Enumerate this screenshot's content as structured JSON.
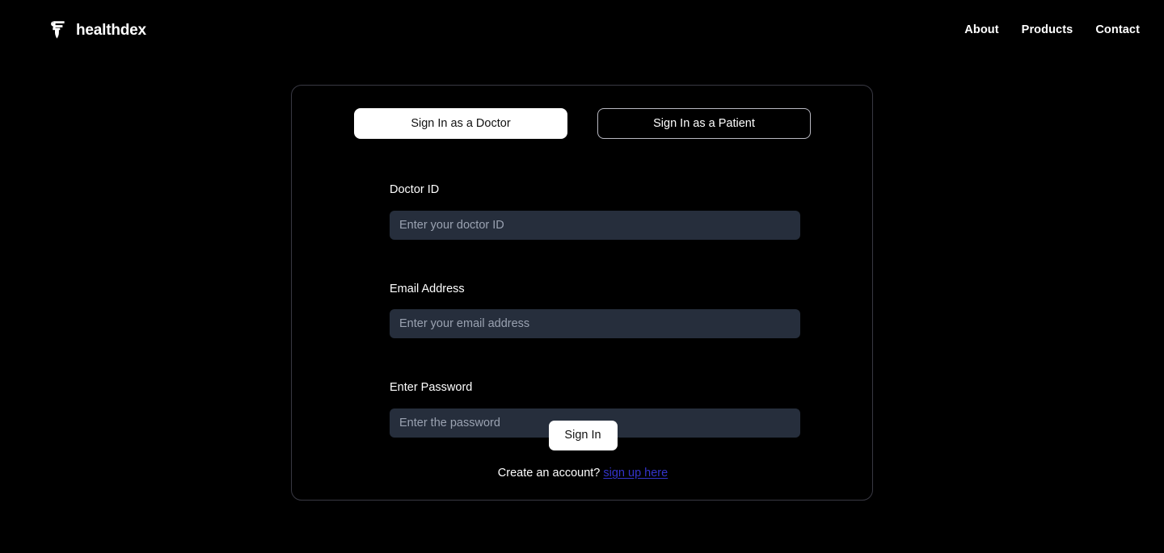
{
  "header": {
    "logo_icon": "healthdex-mark-icon",
    "brand_name": "healthdex",
    "nav": [
      {
        "label": "About"
      },
      {
        "label": "Products"
      },
      {
        "label": "Contact"
      }
    ]
  },
  "card": {
    "tabs": [
      {
        "label": "Sign In as a Doctor",
        "active": true
      },
      {
        "label": "Sign In as a Patient",
        "active": false
      }
    ],
    "fields": [
      {
        "label": "Doctor ID",
        "placeholder": "Enter your doctor ID",
        "value": "",
        "type": "text"
      },
      {
        "label": "Email Address",
        "placeholder": "Enter your email address",
        "value": "",
        "type": "text"
      },
      {
        "label": "Enter Password",
        "placeholder": "Enter the password",
        "value": "",
        "type": "password"
      }
    ],
    "submit_label": "Sign In",
    "signup_prompt": "Create an account?",
    "signup_link_label": "sign up here"
  },
  "colors": {
    "page_background": "#000000",
    "card_border": "#393943",
    "input_background": "#262e3c",
    "placeholder_text": "#9aa2b1",
    "accent_on_white": "#ffffff",
    "link": "#3434cc",
    "tab_inactive_border": "#b9b9c2"
  }
}
